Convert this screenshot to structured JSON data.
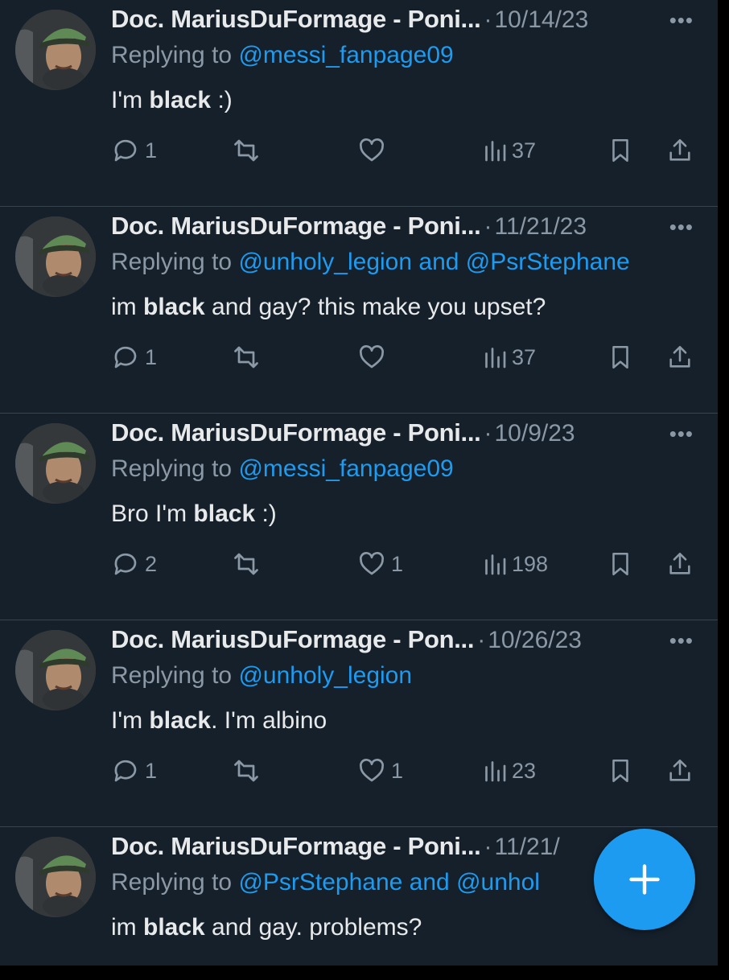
{
  "colors": {
    "background": "#15202b",
    "text": "#e7e9ea",
    "muted": "#8b98a5",
    "link": "#1d9bf0",
    "divider": "#38444d"
  },
  "tweets": [
    {
      "name": "Doc. MariusDuFormage - Poni...",
      "dot": "·",
      "date": "10/14/23",
      "reply_prefix": "Replying to ",
      "mention1": "@messi_fanpage09",
      "conj": "",
      "mention2": "",
      "text_before": "I'm ",
      "text_bold": "black",
      "text_after": " :)",
      "comments": "1",
      "retweets": "",
      "likes": "",
      "views": "37"
    },
    {
      "name": "Doc. MariusDuFormage - Poni...",
      "dot": "·",
      "date": "11/21/23",
      "reply_prefix": "Replying to ",
      "mention1": "@unholy_legion",
      "conj": " and ",
      "mention2": "@PsrStephane",
      "text_before": "im ",
      "text_bold": "black",
      "text_after": " and gay? this make you upset?",
      "comments": "1",
      "retweets": "",
      "likes": "",
      "views": "37"
    },
    {
      "name": "Doc. MariusDuFormage - Poni...",
      "dot": "·",
      "date": "10/9/23",
      "reply_prefix": "Replying to ",
      "mention1": "@messi_fanpage09",
      "conj": "",
      "mention2": "",
      "text_before": "Bro I'm ",
      "text_bold": "black",
      "text_after": " :)",
      "comments": "2",
      "retweets": "",
      "likes": "1",
      "views": "198"
    },
    {
      "name": "Doc. MariusDuFormage - Pon...",
      "dot": "·",
      "date": "10/26/23",
      "reply_prefix": "Replying to ",
      "mention1": "@unholy_legion",
      "conj": "",
      "mention2": "",
      "text_before": "I'm ",
      "text_bold": "black",
      "text_after": ". I'm albino",
      "comments": "1",
      "retweets": "",
      "likes": "1",
      "views": "23"
    },
    {
      "name": "Doc. MariusDuFormage - Poni...",
      "dot": "·",
      "date": "11/21/",
      "reply_prefix": "Replying to ",
      "mention1": "@PsrStephane",
      "conj": " and ",
      "mention2": "@unhol",
      "text_before": "im ",
      "text_bold": "black",
      "text_after": " and gay. problems?",
      "comments": "",
      "retweets": "",
      "likes": "",
      "views": ""
    }
  ],
  "more_label": "•••",
  "icons": {
    "comment": "comment-icon",
    "retweet": "retweet-icon",
    "like": "heart-icon",
    "views": "views-icon",
    "bookmark": "bookmark-icon",
    "share": "share-icon",
    "compose": "plus-icon"
  }
}
